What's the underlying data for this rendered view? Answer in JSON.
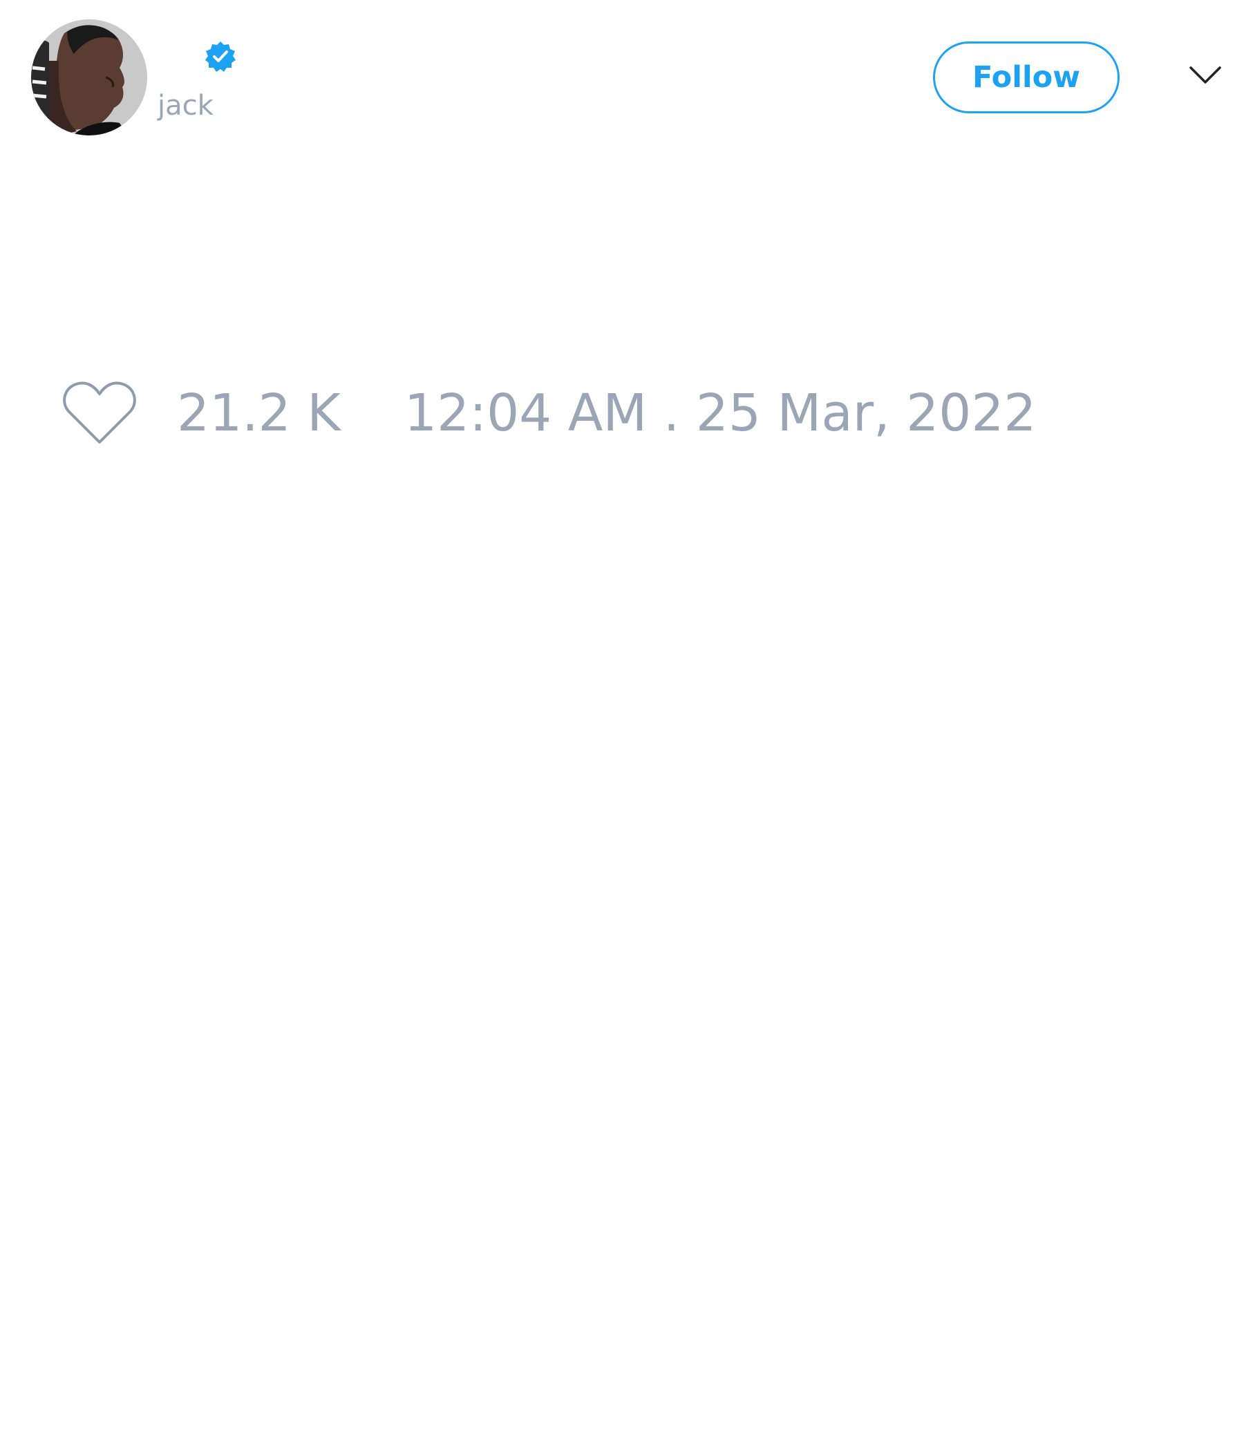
{
  "author": {
    "handle": "jack",
    "verified": true,
    "avatar_icon": "avatar-photo"
  },
  "header": {
    "follow_label": "Follow",
    "menu_icon": "chevron-down-icon"
  },
  "footer": {
    "like_icon": "heart-icon",
    "like_count": "21.2 K",
    "timestamp": "12:04 AM . 25 Mar, 2022"
  },
  "colors": {
    "accent": "#1da1f2",
    "muted_text": "#9aa6b6",
    "background": "#ffffff"
  }
}
